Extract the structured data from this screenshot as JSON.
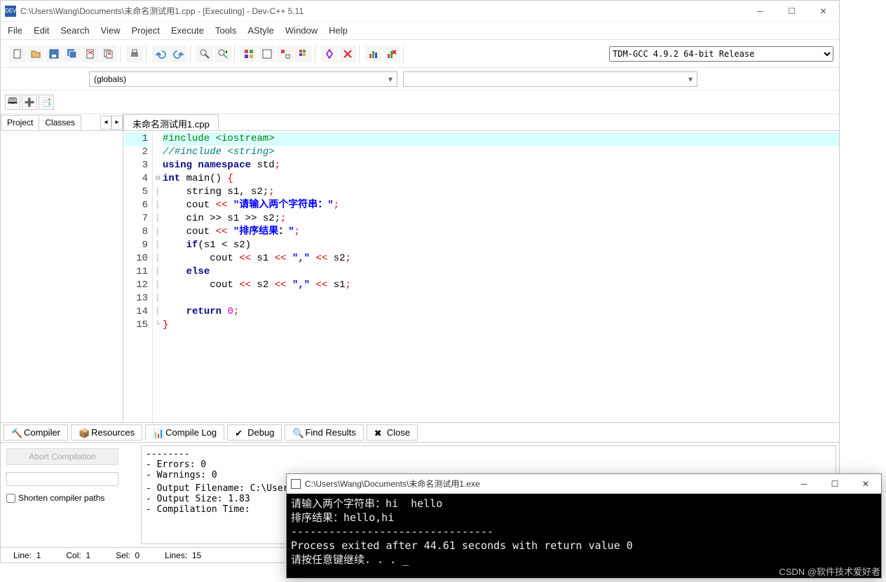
{
  "titlebar": {
    "app_icon_text": "DEV",
    "title": "C:\\Users\\Wang\\Documents\\未命名测试用1.cpp - [Executing] - Dev-C++ 5.11"
  },
  "menubar": [
    "File",
    "Edit",
    "Search",
    "View",
    "Project",
    "Execute",
    "Tools",
    "AStyle",
    "Window",
    "Help"
  ],
  "compiler_select": "TDM-GCC 4.9.2 64-bit Release",
  "scope_select": "(globals)",
  "left_tabs": [
    "Project",
    "Classes"
  ],
  "editor": {
    "tab_label": "未命名测试用1.cpp",
    "line_numbers": [
      1,
      2,
      3,
      4,
      5,
      6,
      7,
      8,
      9,
      10,
      11,
      12,
      13,
      14,
      15
    ],
    "code": {
      "l1": "#include <iostream>",
      "l2": "//#include <string>",
      "l3_a": "using",
      "l3_b": "namespace",
      "l3_c": "std",
      "l4_a": "int",
      "l4_b": "main()",
      "l5": "    string s1, s2;",
      "l6_a": "    cout ",
      "l6_b": "\"请输入两个字符串：\"",
      "l7": "    cin >> s1 >> s2;",
      "l8_a": "    cout ",
      "l8_b": "\"排序结果：\"",
      "l9_a": "    ",
      "l9_b": "if",
      "l9_c": "(s1 < s2)",
      "l10_a": "        cout ",
      "l10_b": "\",\"",
      "l11_a": "    ",
      "l11_b": "else",
      "l12_a": "        cout ",
      "l12_b": "\",\"",
      "l14_a": "    ",
      "l14_b": "return",
      "l14_c": "0"
    }
  },
  "bottom_tabs": [
    "Compiler",
    "Resources",
    "Compile Log",
    "Debug",
    "Find Results",
    "Close"
  ],
  "bottom_tab_active_index": 2,
  "abort_btn": "Abort Compilation",
  "shorten_chk": "Shorten compiler paths",
  "compile_log_lines": [
    "--------",
    "- Errors: 0",
    "- Warnings: 0",
    "- Output Filename: C:\\Users\\Wang\\Documents\\未命名测试用1.exe",
    "- Output Size: 1.83",
    "- Compilation Time:"
  ],
  "status": {
    "line_label": "Line:",
    "line_val": "1",
    "col_label": "Col:",
    "col_val": "1",
    "sel_label": "Sel:",
    "sel_val": "0",
    "lines_label": "Lines:",
    "lines_val": "15"
  },
  "console": {
    "title": "C:\\Users\\Wang\\Documents\\未命名测试用1.exe",
    "lines": [
      "请输入两个字符串：hi  hello",
      "排序结果：hello,hi",
      "--------------------------------",
      "Process exited after 44.61 seconds with return value 0",
      "请按任意键继续. . . _"
    ]
  },
  "watermark": "CSDN @软件技术爱好者"
}
